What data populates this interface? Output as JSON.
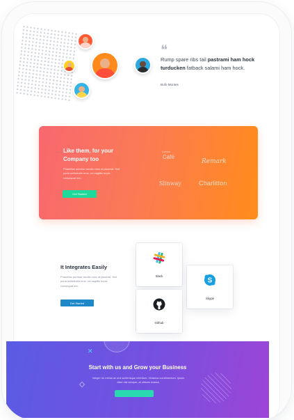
{
  "testimonial": {
    "quote_mark": "❝",
    "quote_plain_1": "Rump spare ribs tail ",
    "quote_bold": "pastrami ham hock turducken",
    "quote_plain_2": " fatback salami ham hock.",
    "author": "Bufo Montes"
  },
  "hero_card": {
    "title": "Like them, for your Company too",
    "description": "Phasellus pulvinar iaculis nunc at placerat. Sed porta sollicitudin eros, vel sagittis turpis consequat nec.",
    "button_label": "Get Started",
    "logos": {
      "cafe_top": "COFFEE",
      "cafe": "Café",
      "remark": "Remark",
      "slinway": "Slinway",
      "charlitton": "Charlitton"
    },
    "gradient_start": "#f8676f",
    "gradient_end": "#ff8d1a",
    "button_color": "#1fd99b"
  },
  "integrations": {
    "title": "It Integrates Easily",
    "description": "Phasellus pulvinar iaculis nunc at placerat. Sed porta sollicitudin eros, vel sagittis turpis consequat nec.",
    "button_label": "Get Started",
    "button_color": "#1f88c8",
    "tiles": [
      {
        "label": "Slack",
        "icon": "slack-icon"
      },
      {
        "label": "Skype",
        "icon": "skype-icon"
      },
      {
        "label": "Github",
        "icon": "github-icon"
      }
    ]
  },
  "banner": {
    "title": "Start with us and Grow your Business",
    "description": "Integer eu metus ac orci scelerisque interdum. Vivamus condimentum, ipsum vitae nisi semper, at ultrices massa.",
    "gradient_start": "#5a5be4",
    "gradient_end": "#9d45d6"
  }
}
